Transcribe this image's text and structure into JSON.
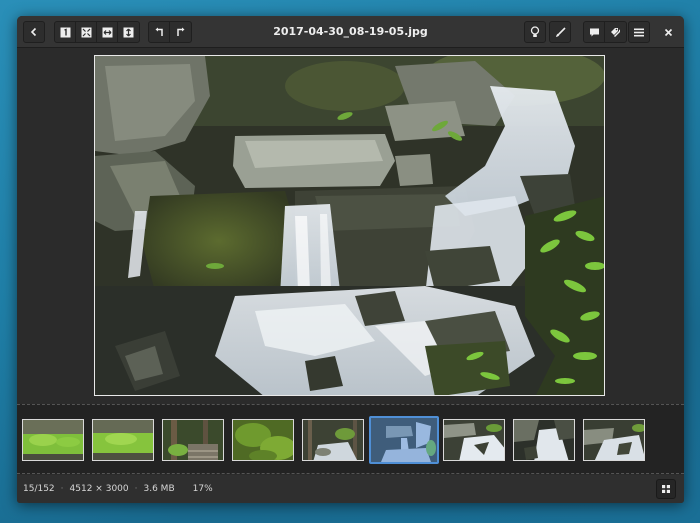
{
  "window": {
    "title": "2017-04-30_08-19-05.jpg"
  },
  "toolbar": {
    "back_icon": "chevron-left-icon",
    "zoom_buttons": [
      "zoom-1-1-icon",
      "zoom-fit-icon",
      "fit-width-icon",
      "fit-height-icon"
    ],
    "rotate_buttons": [
      "rotate-left-icon",
      "rotate-right-icon"
    ],
    "right_buttons": [
      "lightbulb-icon",
      "brush-icon",
      "comment-icon",
      "tags-icon",
      "menu-icon",
      "close-icon"
    ]
  },
  "filmstrip": {
    "count_visible": 9,
    "selected_index": 5,
    "thumbs": [
      {
        "palette": "fern"
      },
      {
        "palette": "fern"
      },
      {
        "palette": "forest-steps"
      },
      {
        "palette": "moss"
      },
      {
        "palette": "creek"
      },
      {
        "palette": "waterfall"
      },
      {
        "palette": "rapids"
      },
      {
        "palette": "rapids-dark"
      },
      {
        "palette": "rapids"
      }
    ]
  },
  "status": {
    "position": "15/152",
    "dimensions": "4512 × 3000",
    "filesize": "3.6 MB",
    "zoom": "17%"
  },
  "colors": {
    "accent": "#4f8fd6",
    "window_bg": "#2b2b2b",
    "headerbar": "#343434"
  }
}
